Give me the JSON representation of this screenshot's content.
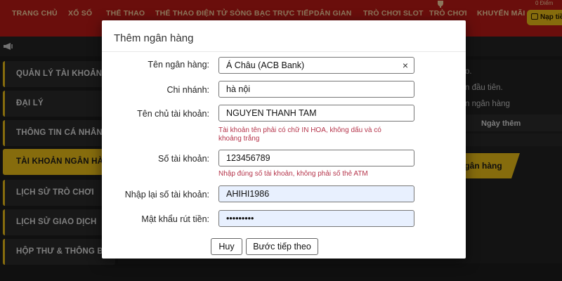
{
  "nav": {
    "items": [
      "TRANG CHỦ",
      "XỔ SỐ",
      "THỂ THAO",
      "THỂ THAO ĐIỆN TỬ",
      "SÒNG BẠC TRỰC TIẾP",
      "DÂN GIAN",
      "TRÒ CHƠI SLOT",
      "TRÒ CHƠI",
      "KHUYẾN MÃI"
    ],
    "recharge_label": "Nạp tiền",
    "balance": "0 Điểm",
    "colors": {
      "bar": "#c21b17",
      "text": "#ffd9a8",
      "accent": "#f5c518"
    }
  },
  "sidebar": {
    "items": [
      "QUẢN LÝ TÀI KHOẢN",
      "ĐẠI LÝ",
      "THÔNG TIN CÁ NHÂN",
      "TÀI KHOẢN NGÂN HÀNG",
      "LỊCH SỬ TRÒ CHƠI",
      "LỊCH SỬ GIAO DỊCH",
      "HỘP THƯ & THÔNG BÁO"
    ],
    "active_index": 3
  },
  "background": {
    "text_1": "o.",
    "text_2": "n đầu tiên.",
    "text_3": "n ngân hàng",
    "column_header": "Ngày thêm",
    "add_button": "ngân hàng"
  },
  "modal": {
    "title": "Thêm ngân hàng",
    "bank_name": {
      "label": "Tên ngân hàng:",
      "value": "Á Châu (ACB Bank)"
    },
    "branch": {
      "label": "Chi nhánh:",
      "value": "hà nội"
    },
    "account_holder": {
      "label": "Tên chủ tài khoản:",
      "value": "NGUYEN THANH TAM",
      "error_line1": "Tài khoản tên phải có chữ IN HOA, không dấu và có",
      "error_line2": "khoảng trắng"
    },
    "account_number": {
      "label": "Số tài khoản:",
      "value": "123456789",
      "error": "Nhập đúng số tài khoản, không phải số thẻ ATM"
    },
    "confirm_account": {
      "label": "Nhập lại số tài khoản:",
      "value": "AHIHI1986"
    },
    "withdraw_password": {
      "label": "Mật khẩu rút tiền:",
      "value": "•••••••••"
    },
    "cancel_label": "Huy",
    "next_label": "Bước tiếp theo"
  }
}
